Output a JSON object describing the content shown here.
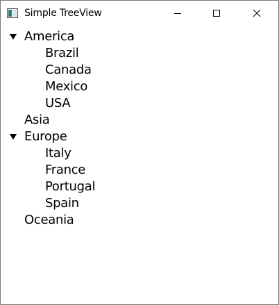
{
  "window": {
    "title": "Simple TreeView"
  },
  "tree": {
    "roots": [
      {
        "label": "America",
        "expanded": true,
        "children": [
          "Brazil",
          "Canada",
          "Mexico",
          "USA"
        ]
      },
      {
        "label": "Asia",
        "expanded": false,
        "children": []
      },
      {
        "label": "Europe",
        "expanded": true,
        "children": [
          "Italy",
          "France",
          "Portugal",
          "Spain"
        ]
      },
      {
        "label": "Oceania",
        "expanded": false,
        "children": []
      }
    ]
  }
}
